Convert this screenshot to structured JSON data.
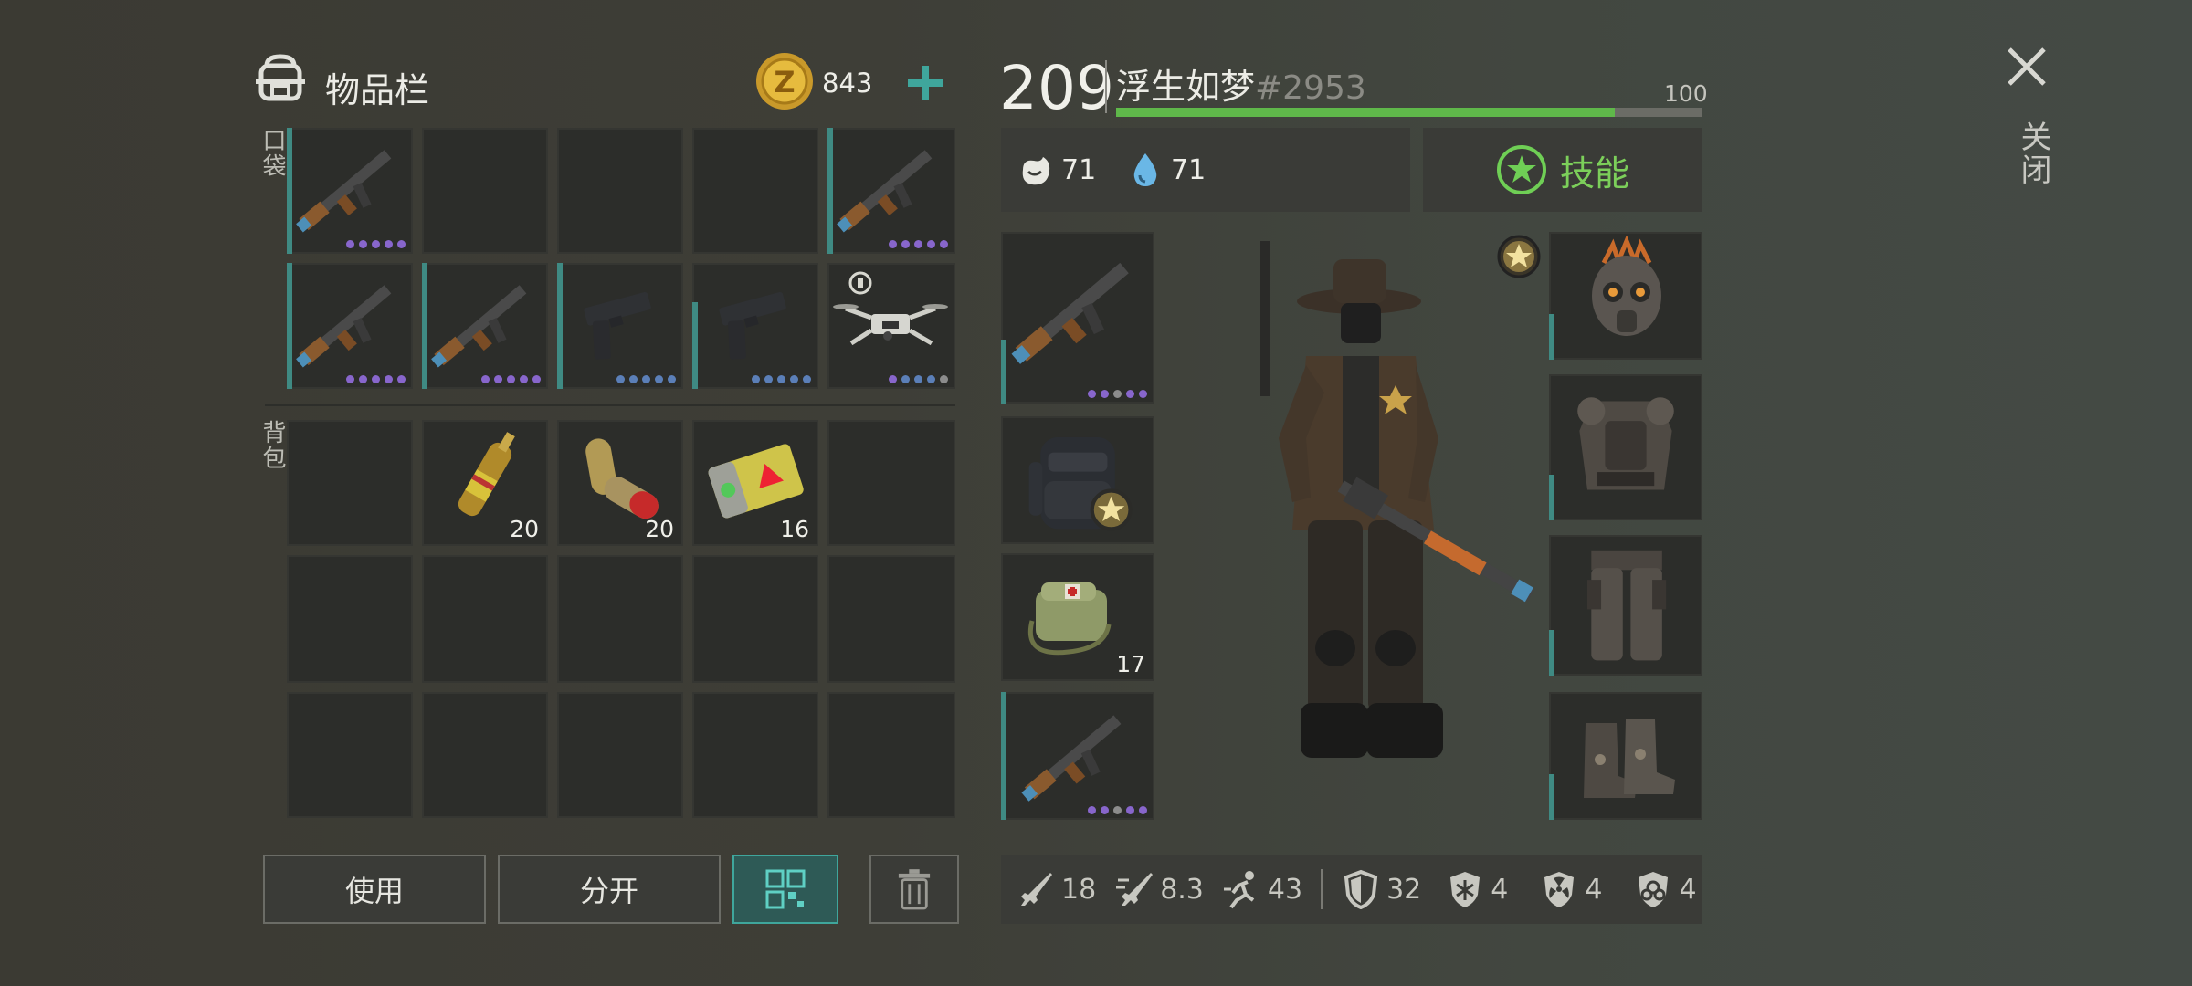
{
  "inventory": {
    "title": "物品栏",
    "coins": "843",
    "pocket_label": "口袋",
    "backpack_label": "背包",
    "backpack_slots": [
      {
        "item": "adrenaline-ampoule",
        "qty": "20"
      },
      {
        "item": "capsules",
        "qty": "20"
      },
      {
        "item": "battery-pack",
        "qty": "16"
      }
    ]
  },
  "buttons": {
    "use": "使用",
    "split": "分开"
  },
  "player": {
    "level": "209",
    "name": "浮生如梦",
    "id": "#2953",
    "health_max": "100",
    "health_fraction": 0.85,
    "food": "71",
    "water": "71",
    "skills_label": "技能"
  },
  "equipment": {
    "medkit_qty": "17"
  },
  "stats": {
    "melee": "18",
    "melee_speed": "8.3",
    "speed": "43",
    "armor": "32",
    "cold": "4",
    "radiation": "4",
    "toxic": "4"
  },
  "close_label": "关闭",
  "colors": {
    "accent": "#3f8a83",
    "health": "#5fb84a",
    "skill": "#7ccf5a",
    "rarity": "#8866cc"
  }
}
